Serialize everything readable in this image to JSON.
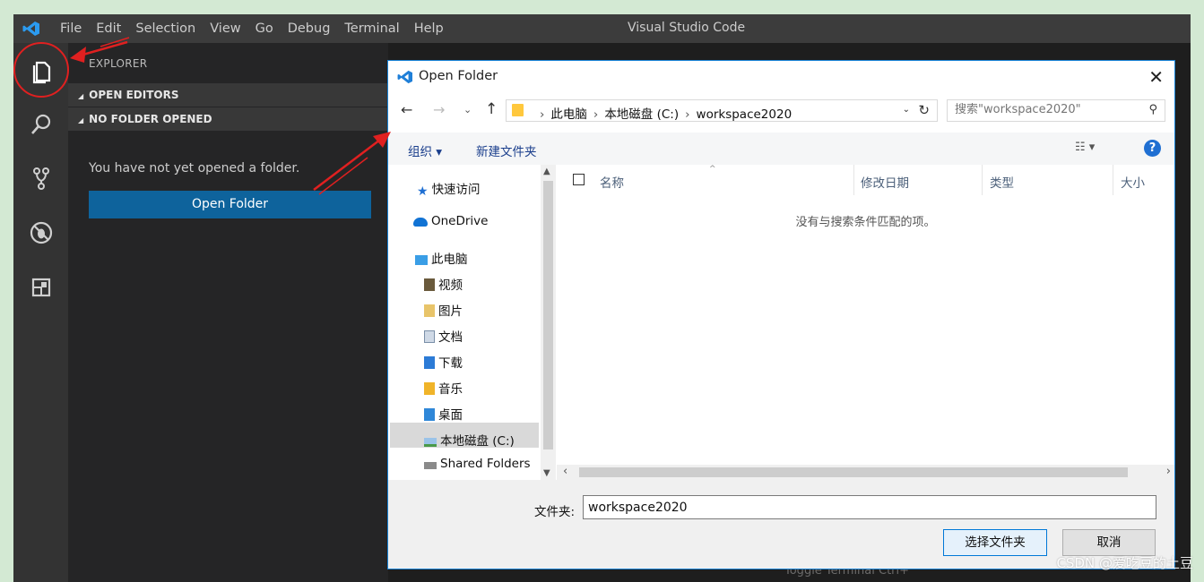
{
  "colors": {
    "accent_blue": "#0e639c",
    "dialog_border": "#1883d7",
    "annotation_red": "#e02020",
    "titlebar": "#3c3c3c",
    "sidebar": "#252526",
    "activitybar": "#333333"
  },
  "vscode": {
    "menu": [
      "File",
      "Edit",
      "Selection",
      "View",
      "Go",
      "Debug",
      "Terminal",
      "Help"
    ],
    "window_title": "Visual Studio Code",
    "activity_icons": [
      "explorer-icon",
      "search-icon",
      "source-control-icon",
      "debug-icon",
      "extensions-icon"
    ],
    "sidebar": {
      "title": "EXPLORER",
      "open_editors": "OPEN EDITORS",
      "no_folder": "NO FOLDER OPENED",
      "message": "You have not yet opened a folder.",
      "open_folder_button": "Open Folder"
    },
    "status_hint": "Toggle Terminal    Ctrl+"
  },
  "dialog": {
    "title": "Open Folder",
    "address": {
      "segments": [
        "此电脑",
        "本地磁盘 (C:)",
        "workspace2020"
      ]
    },
    "search_placeholder": "搜索\"workspace2020\"",
    "toolbar": {
      "organize": "组织 ▾",
      "new_folder": "新建文件夹"
    },
    "nav_items": [
      {
        "label": "快速访问",
        "icon": "star-icon"
      },
      {
        "label": "OneDrive",
        "icon": "cloud-icon"
      },
      {
        "label": "此电脑",
        "icon": "computer-icon"
      },
      {
        "label": "视频",
        "icon": "video-folder-icon"
      },
      {
        "label": "图片",
        "icon": "pictures-folder-icon"
      },
      {
        "label": "文档",
        "icon": "documents-folder-icon"
      },
      {
        "label": "下载",
        "icon": "downloads-folder-icon"
      },
      {
        "label": "音乐",
        "icon": "music-folder-icon"
      },
      {
        "label": "桌面",
        "icon": "desktop-folder-icon"
      },
      {
        "label": "本地磁盘 (C:)",
        "icon": "drive-icon"
      },
      {
        "label": "Shared Folders",
        "icon": "network-folder-icon"
      }
    ],
    "selected_nav": "本地磁盘 (C:)",
    "columns": [
      "名称",
      "修改日期",
      "类型",
      "大小"
    ],
    "empty_message": "没有与搜索条件匹配的项。",
    "folder_label": "文件夹:",
    "folder_value": "workspace2020",
    "select_button": "选择文件夹",
    "cancel_button": "取消"
  },
  "watermark": "CSDN @爱吃豆的土豆"
}
